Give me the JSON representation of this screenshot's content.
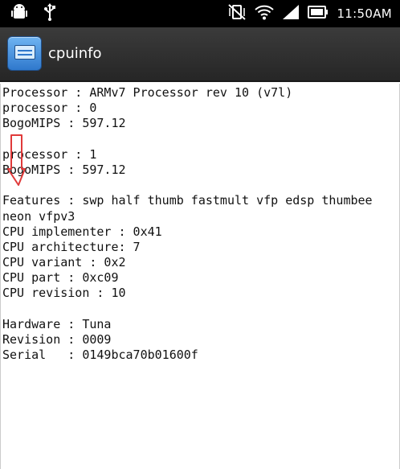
{
  "status_bar": {
    "time": "11:50AM",
    "icons": [
      "android-debug-icon",
      "usb-icon",
      "vibrate-off-icon",
      "wifi-icon",
      "signal-icon",
      "battery-icon"
    ]
  },
  "action_bar": {
    "title": "cpuinfo",
    "icon": "cpuinfo-app-icon"
  },
  "cpuinfo": {
    "lines": [
      "Processor : ARMv7 Processor rev 10 (v7l)",
      "processor : 0",
      "BogoMIPS : 597.12",
      "",
      "processor : 1",
      "BogoMIPS : 597.12",
      "",
      "Features : swp half thumb fastmult vfp edsp thumbee",
      "neon vfpv3",
      "CPU implementer : 0x41",
      "CPU architecture: 7",
      "CPU variant : 0x2",
      "CPU part : 0xc09",
      "CPU revision : 10",
      "",
      "Hardware : Tuna",
      "Revision : 0009",
      "Serial   : 0149bca70b01600f"
    ]
  },
  "colors": {
    "status_bar": "#000000",
    "action_bar": "#2e2e2e",
    "annotation_arrow": "#e03a3a"
  }
}
